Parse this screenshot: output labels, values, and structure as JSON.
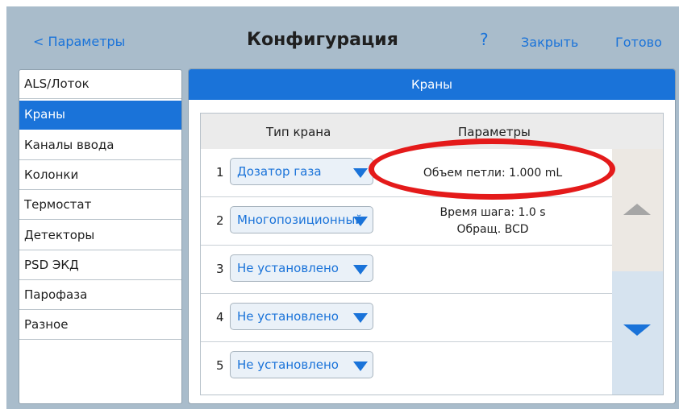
{
  "header": {
    "back_label": "< Параметры",
    "title": "Конфигурация",
    "help_label": "?",
    "close_label": "Закрыть",
    "done_label": "Готово"
  },
  "sidebar": {
    "items": [
      {
        "label": "ALS/Лоток"
      },
      {
        "label": "Краны",
        "active": true
      },
      {
        "label": "Каналы ввода"
      },
      {
        "label": "Колонки"
      },
      {
        "label": "Термостат"
      },
      {
        "label": "Детекторы"
      },
      {
        "label": "PSD ЭКД"
      },
      {
        "label": "Парофаза"
      },
      {
        "label": "Разное"
      }
    ]
  },
  "main": {
    "title": "Краны",
    "columns": {
      "type": "Тип крана",
      "params": "Параметры"
    },
    "rows": [
      {
        "num": "1",
        "type": "Дозатор газа",
        "params": [
          "Объем петли: 1.000 mL"
        ]
      },
      {
        "num": "2",
        "type": "Многопозиционный",
        "params": [
          "Время шага: 1.0 s",
          "Обращ. BCD"
        ]
      },
      {
        "num": "3",
        "type": "Не установлено",
        "params": []
      },
      {
        "num": "4",
        "type": "Не установлено",
        "params": []
      },
      {
        "num": "5",
        "type": "Не установлено",
        "params": []
      }
    ]
  },
  "colors": {
    "accent": "#1a73d9",
    "background": "#a9bccb",
    "annotation": "#e41a1a"
  },
  "icons": [
    "scroll-up-icon",
    "scroll-down-icon",
    "dropdown-arrow-icon"
  ]
}
